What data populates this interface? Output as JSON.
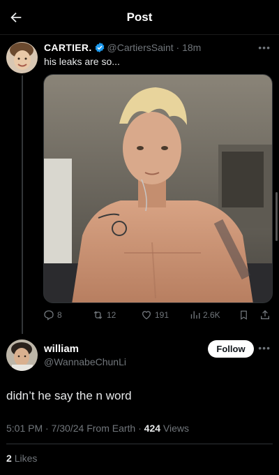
{
  "header": {
    "title": "Post"
  },
  "quoted": {
    "name": "CARTIER.",
    "handle": "@CartiersSaint",
    "time": "18m",
    "text": "his leaks are so..."
  },
  "actions": {
    "replies": "8",
    "reposts": "12",
    "likes": "191",
    "views": "2.6K"
  },
  "post": {
    "author_name": "william",
    "author_handle": "@WannabeChunLi",
    "follow_label": "Follow",
    "text": "didn’t he say the n word",
    "time": "5:01 PM",
    "date": "7/30/24",
    "source": "From Earth",
    "views_count": "424",
    "views_label": "Views",
    "likes_count": "2",
    "likes_label": "Likes"
  },
  "colors": {
    "background": "#000000",
    "muted": "#71767b",
    "verified": "#1d9bf0"
  }
}
